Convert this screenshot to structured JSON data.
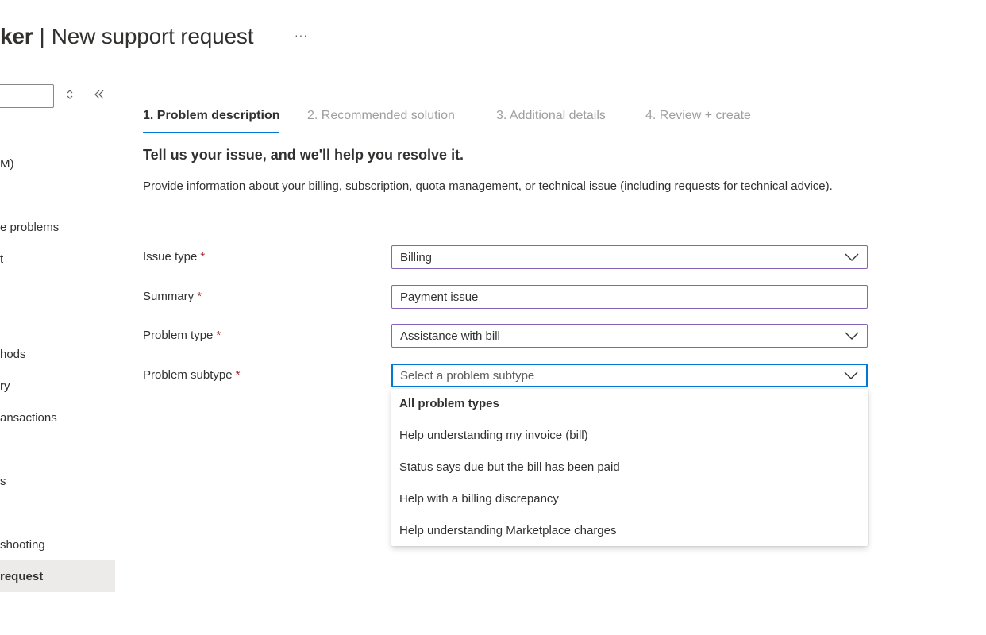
{
  "header": {
    "title_bold": "ker",
    "separator": "|",
    "title": "New support request",
    "more_label": "···"
  },
  "sidebar": {
    "search_value": "",
    "items": [
      {
        "label": "M)"
      },
      {
        "label": "e problems"
      },
      {
        "label": "t"
      },
      {
        "label": "hods"
      },
      {
        "label": "ry"
      },
      {
        "label": "ansactions"
      },
      {
        "label": "s"
      },
      {
        "label": "shooting"
      },
      {
        "label": "request"
      }
    ]
  },
  "tabs": [
    {
      "label": "1. Problem description"
    },
    {
      "label": "2. Recommended solution"
    },
    {
      "label": "3. Additional details"
    },
    {
      "label": "4. Review + create"
    }
  ],
  "form": {
    "heading": "Tell us your issue, and we'll help you resolve it.",
    "description": "Provide information about your billing, subscription, quota management, or technical issue (including requests for technical advice).",
    "required_marker": "*",
    "issue_type": {
      "label": "Issue type",
      "value": "Billing"
    },
    "summary": {
      "label": "Summary",
      "value": "Payment issue"
    },
    "problem_type": {
      "label": "Problem type",
      "value": "Assistance with bill"
    },
    "problem_subtype": {
      "label": "Problem subtype",
      "placeholder": "Select a problem subtype"
    }
  },
  "subtype_dropdown": {
    "group_header": "All problem types",
    "options": [
      "Help understanding my invoice (bill)",
      "Status says due but the bill has been paid",
      "Help with a billing discrepancy",
      "Help understanding Marketplace charges"
    ]
  },
  "colors": {
    "accent": "#0078d4",
    "control_border": "#8764b8",
    "required": "#a4262c",
    "selected_bg": "#edebe9"
  }
}
